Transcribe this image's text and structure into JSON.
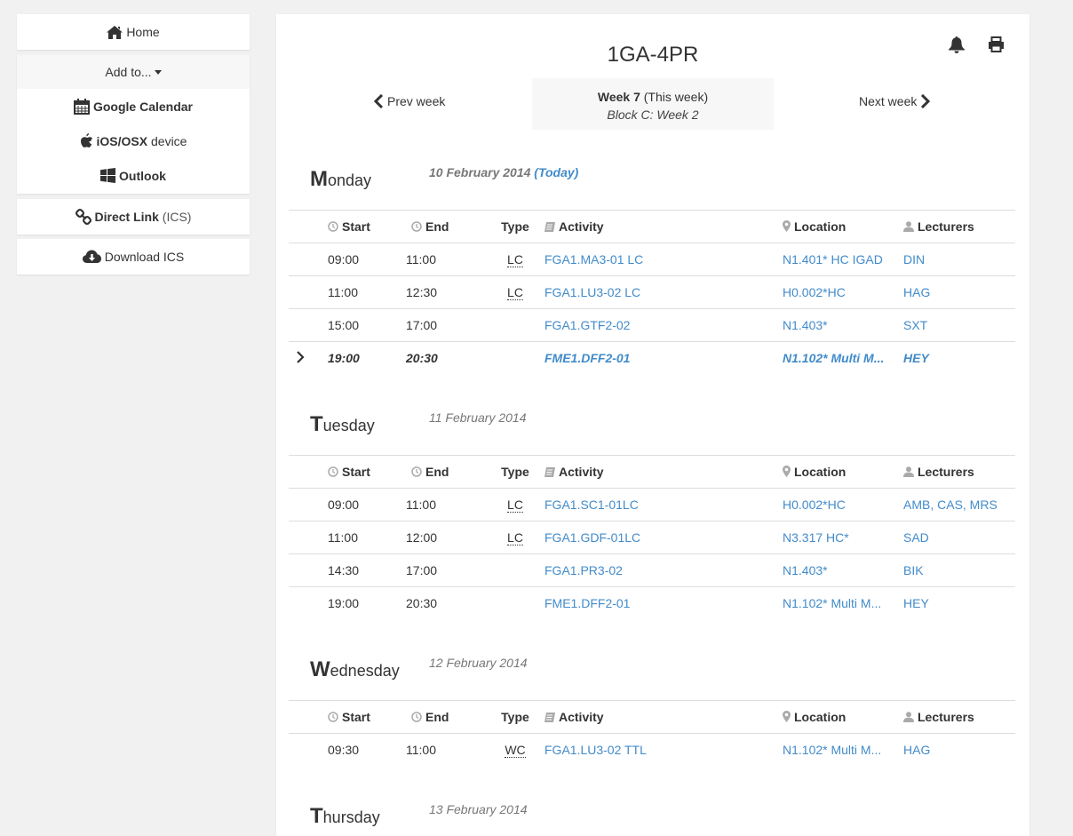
{
  "sidebar": {
    "home": "Home",
    "add_to": "Add to...",
    "google": "Google Calendar",
    "ios_bold": "iOS/OSX",
    "ios_rest": " device",
    "outlook": "Outlook",
    "direct_bold": "Direct Link",
    "direct_rest": " (ICS)",
    "download": "Download ICS"
  },
  "header": {
    "title": "1GA-4PR",
    "prev": "Prev week",
    "next": "Next week",
    "week_bold": "Week 7",
    "week_rest": " (This week)",
    "block": "Block C: Week 2"
  },
  "columns": {
    "start": "Start",
    "end": "End",
    "type": "Type",
    "activity": "Activity",
    "location": "Location",
    "lecturers": "Lecturers"
  },
  "days": [
    {
      "initial": "M",
      "rest": "onday",
      "date": "10 February 2014",
      "today": "(Today)",
      "rows": [
        {
          "start": "09:00",
          "end": "11:00",
          "type": "LC",
          "activity": "FGA1.MA3-01 LC",
          "location": "N1.401* HC IGAD",
          "lecturers": "DIN"
        },
        {
          "start": "11:00",
          "end": "12:30",
          "type": "LC",
          "activity": "FGA1.LU3-02 LC",
          "location": "H0.002*HC",
          "lecturers": "HAG"
        },
        {
          "start": "15:00",
          "end": "17:00",
          "type": "",
          "activity": "FGA1.GTF2-02",
          "location": "N1.403*",
          "lecturers": "SXT"
        },
        {
          "start": "19:00",
          "end": "20:30",
          "type": "",
          "activity": "FME1.DFF2-01",
          "location": "N1.102* Multi M...",
          "lecturers": "HEY",
          "current": true
        }
      ]
    },
    {
      "initial": "T",
      "rest": "uesday",
      "date": "11 February 2014",
      "rows": [
        {
          "start": "09:00",
          "end": "11:00",
          "type": "LC",
          "activity": "FGA1.SC1-01LC",
          "location": "H0.002*HC",
          "lecturers": "AMB, CAS, MRS"
        },
        {
          "start": "11:00",
          "end": "12:00",
          "type": "LC",
          "activity": "FGA1.GDF-01LC",
          "location": "N3.317 HC*",
          "lecturers": "SAD"
        },
        {
          "start": "14:30",
          "end": "17:00",
          "type": "",
          "activity": "FGA1.PR3-02",
          "location": "N1.403*",
          "lecturers": "BIK"
        },
        {
          "start": "19:00",
          "end": "20:30",
          "type": "",
          "activity": "FME1.DFF2-01",
          "location": "N1.102* Multi M...",
          "lecturers": "HEY"
        }
      ]
    },
    {
      "initial": "W",
      "rest": "ednesday",
      "date": "12 February 2014",
      "rows": [
        {
          "start": "09:30",
          "end": "11:00",
          "type": "WC",
          "activity": "FGA1.LU3-02 TTL",
          "location": "N1.102* Multi M...",
          "lecturers": "HAG"
        }
      ]
    },
    {
      "initial": "T",
      "rest": "hursday",
      "date": "13 February 2014",
      "rows": []
    }
  ]
}
